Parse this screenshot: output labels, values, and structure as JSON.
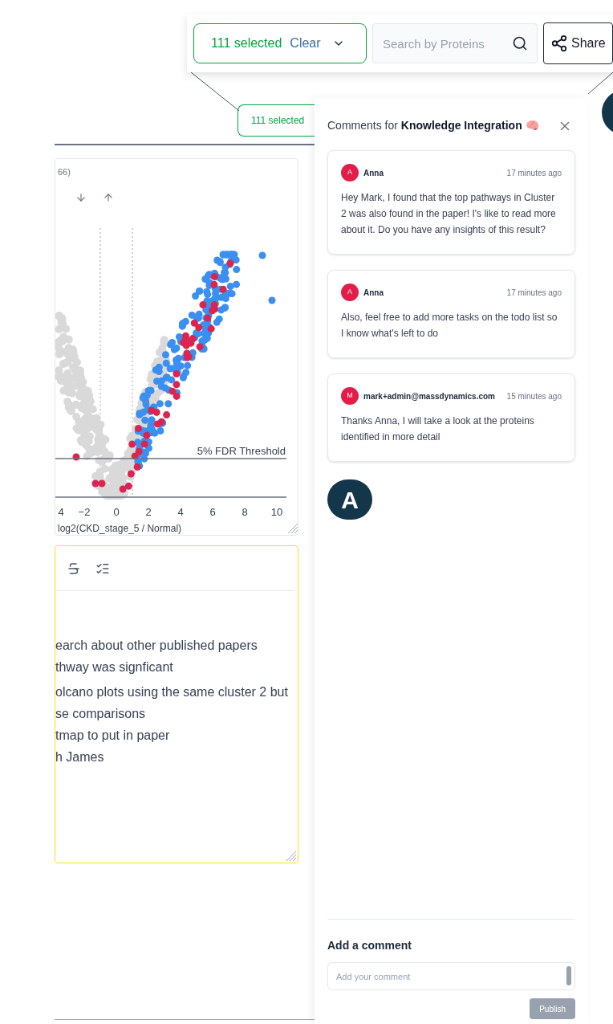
{
  "toolbar": {
    "selection": {
      "count_label": "111 selected",
      "clear_label": "Clear"
    },
    "search": {
      "placeholder": "Search by Proteins"
    },
    "share_label": "Share"
  },
  "selection_chip": {
    "label": "111 selected"
  },
  "plot": {
    "title_fragment": "66)",
    "threshold_label": "5% FDR Threshold",
    "x_tick_labels": [
      "4",
      "−2",
      "0",
      "2",
      "4",
      "6",
      "8",
      "10"
    ],
    "x_axis_label": "log2(CKD_stage_5 / Normal)"
  },
  "notes": {
    "lines": [
      "earch about other published papers",
      "thway was signficant",
      "olcano plots using the same cluster 2 but",
      "se comparisons",
      "tmap to put in paper",
      "h James"
    ]
  },
  "comments_panel": {
    "title_prefix": "Comments for",
    "title_bold": "Knowledge Integration",
    "title_emoji": "🧠",
    "comments": [
      {
        "avatar": "A",
        "author": "Anna",
        "time": "17 minutes ago",
        "text": "Hey Mark, I found that the top pathways in Cluster 2 was also found in the paper! I's like to read more about it. Do you have any insights of this result?"
      },
      {
        "avatar": "A",
        "author": "Anna",
        "time": "17 minutes ago",
        "text": "Also, feel free to add more tasks on the todo list so I know what's left to do"
      },
      {
        "avatar": "M",
        "author": "mark+admin@massdynamics.com",
        "time": "15 minutes ago",
        "text": "Thanks Anna, I will take a look at the proteins identified in more detail"
      }
    ],
    "logo_letter": "A",
    "add_heading": "Add a comment",
    "input_placeholder": "Add your comment",
    "publish_label": "Publish"
  }
}
